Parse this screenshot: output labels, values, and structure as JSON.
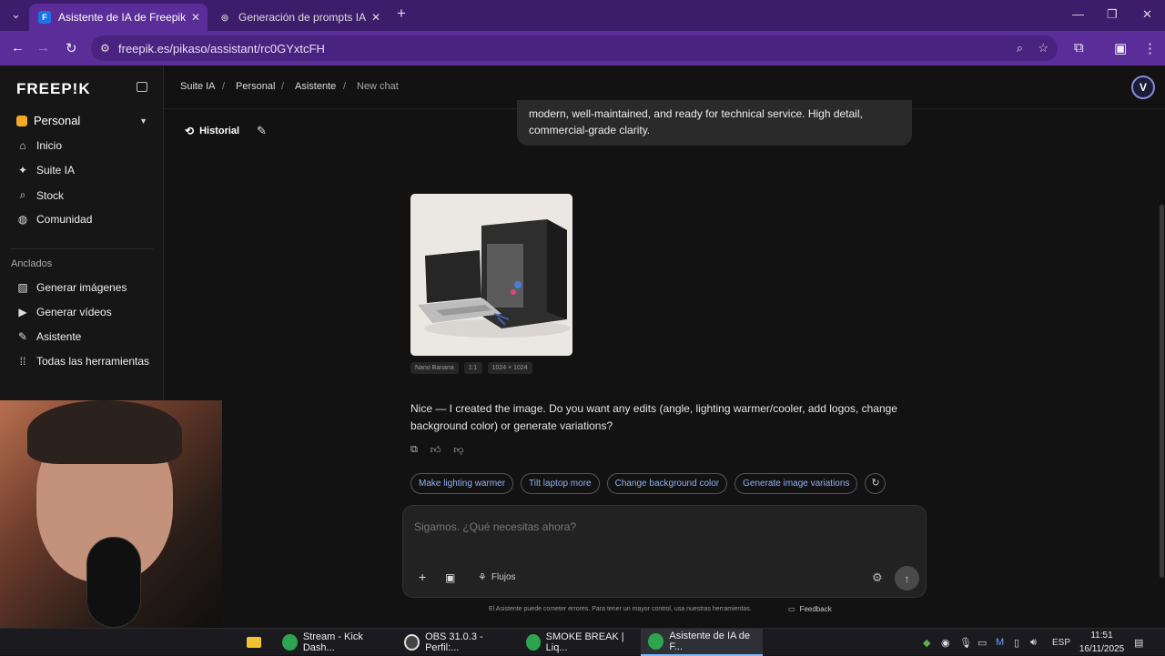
{
  "browser": {
    "tabs": [
      {
        "title": "Asistente de IA de Freepik: crea",
        "favicon": "F",
        "active": true
      },
      {
        "title": "Generación de prompts IA",
        "favicon": "◎",
        "active": false
      }
    ],
    "new_tab": "+",
    "url": "freepik.es/pikaso/assistant/rc0GYxtcFH"
  },
  "sidebar": {
    "logo": "FREEP!K",
    "workspace": "Personal",
    "nav": [
      {
        "label": "Inicio",
        "icon": "home-icon"
      },
      {
        "label": "Suite IA",
        "icon": "sparkle-icon"
      },
      {
        "label": "Stock",
        "icon": "search-icon"
      },
      {
        "label": "Comunidad",
        "icon": "globe-icon"
      }
    ],
    "pinned_header": "Anclados",
    "pinned": [
      {
        "label": "Generar imágenes",
        "icon": "image-icon"
      },
      {
        "label": "Generar vídeos",
        "icon": "video-icon"
      },
      {
        "label": "Asistente",
        "icon": "assistant-icon"
      },
      {
        "label": "Todas las herramientas",
        "icon": "grid-icon"
      }
    ]
  },
  "topbar": {
    "breadcrumb": [
      "Suite IA",
      "Personal",
      "Asistente",
      "New chat"
    ],
    "separator": "/",
    "avatar": "V"
  },
  "chat": {
    "historial_label": "Historial",
    "user_message": "modern, well-maintained, and ready for technical service. High detail, commercial-grade clarity.",
    "image_meta": [
      "Nano Banana",
      "1:1",
      "1024 × 1024"
    ],
    "assistant_reply": "Nice — I created the image. Do you want any edits (angle, lighting warmer/cooler, add logos, change background color) or generate variations?",
    "suggestions": [
      "Make lighting warmer",
      "Tilt laptop more",
      "Change background color",
      "Generate image variations"
    ]
  },
  "composer": {
    "placeholder": "Sigamos. ¿Qué necesitas ahora?",
    "flujos_label": "Flujos"
  },
  "footer": {
    "disclaimer": "El Asistente puede cometer errores. Para tener un mayor control, usa nuestras herramientas.",
    "feedback": "Feedback"
  },
  "taskbar": {
    "items": [
      {
        "label": "Stream - Kick Dash...",
        "color": "#2ea44f"
      },
      {
        "label": "OBS 31.0.3 - Perfil:...",
        "color": "#444"
      },
      {
        "label": "SMOKE BREAK | Liq...",
        "color": "#2ea44f"
      },
      {
        "label": "Asistente de IA de F...",
        "color": "#2ea44f",
        "active": true
      }
    ],
    "lang": "ESP",
    "time": "11:51",
    "date": "16/11/2025"
  }
}
